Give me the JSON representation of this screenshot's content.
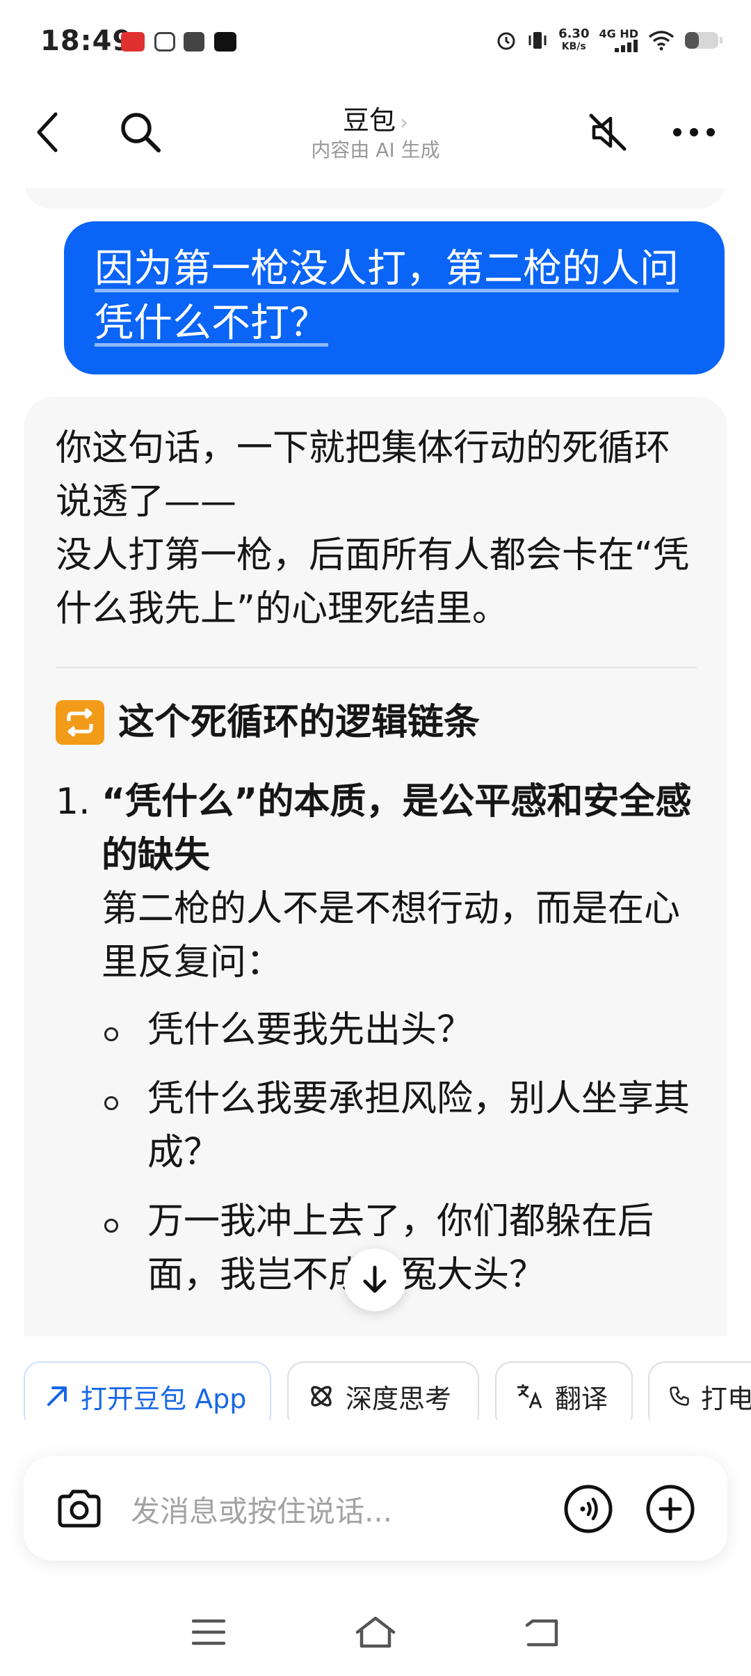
{
  "status_bar": {
    "time": "18:49",
    "net_speed_value": "6.30",
    "net_speed_unit": "KB/s",
    "net_type": "4G HD"
  },
  "header": {
    "title": "豆包",
    "title_chevron": "›",
    "subtitle": "内容由 AI 生成"
  },
  "user_message": {
    "text": "因为第一枪没人打，第二枪的人问凭什么不打？"
  },
  "ai_message": {
    "intro_lines": [
      "你这句话，一下就把集体行动的死循环说透了——",
      "没人打第一枪，后面所有人都会卡在“凭什么我先上”的心理死结里。"
    ],
    "section_title": "这个死循环的逻辑链条",
    "section_icon": "repeat-icon",
    "items": [
      {
        "number": "1.",
        "heading": "“凭什么”的本质，是公平感和安全感的缺失",
        "body": "第二枪的人不是不想行动，而是在心里反复问：",
        "sub_items": [
          "凭什么要我先出头？",
          "凭什么我要承担风险，别人坐享其成？",
          "万一我冲上去了，你们都躲在后面，我岂不成了冤大头？"
        ]
      }
    ]
  },
  "quick_actions": [
    {
      "label": "打开豆包 App",
      "icon": "external-arrow-icon"
    },
    {
      "label": "深度思考",
      "icon": "atom-icon"
    },
    {
      "label": "翻译",
      "icon": "translate-icon"
    },
    {
      "label": "打电话",
      "icon": "phone-icon"
    }
  ],
  "input": {
    "placeholder": "发消息或按住说话..."
  },
  "colors": {
    "accent": "#0a64f5",
    "card_bg": "#f7f7f8",
    "section_icon_bg": "#f29b18"
  }
}
